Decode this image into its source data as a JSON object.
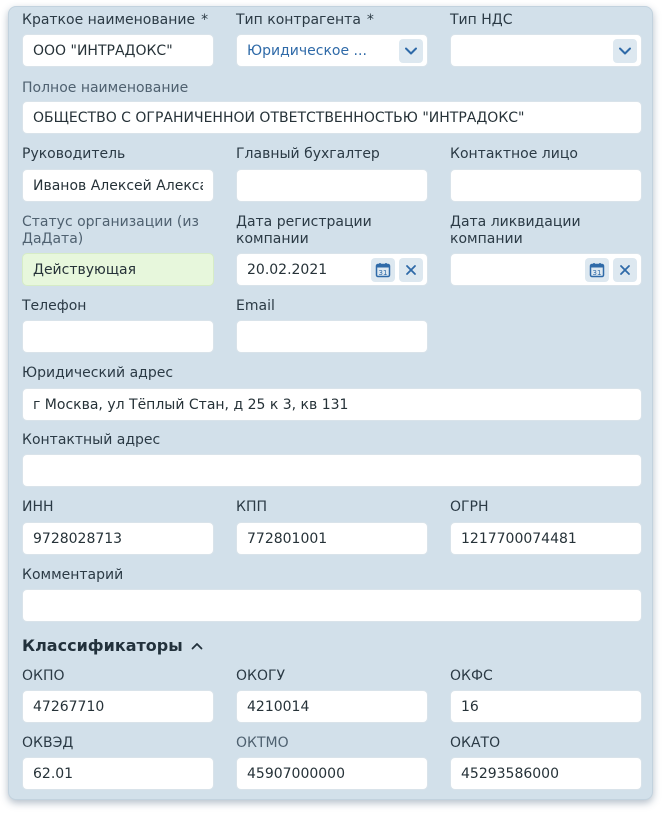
{
  "form": {
    "short_name_label": "Краткое наименование",
    "short_name_required": "*",
    "short_name_value": "ООО \"ИНТРАДОКС\"",
    "contractor_type_label": "Тип контрагента",
    "contractor_type_required": "*",
    "contractor_type_value": "Юридическое ...",
    "vat_type_label": "Тип НДС",
    "vat_type_value": "",
    "full_name_label": "Полное наименование",
    "full_name_value": "ОБЩЕСТВО С ОГРАНИЧЕННОЙ ОТВЕТСТВЕННОСТЬЮ \"ИНТРАДОКС\"",
    "director_label": "Руководитель",
    "director_value": "Иванов Алексей Александрович",
    "chief_accountant_label": "Главный бухгалтер",
    "chief_accountant_value": "",
    "contact_person_label": "Контактное лицо",
    "contact_person_value": "",
    "org_status_label": "Статус организации (из ДаДата)",
    "org_status_value": "Действующая",
    "reg_date_label": "Дата регистрации компании",
    "reg_date_value": "20.02.2021",
    "liquidation_date_label": "Дата ликвидации компании",
    "liquidation_date_value": "",
    "phone_label": "Телефон",
    "phone_value": "",
    "email_label": "Email",
    "email_value": "",
    "legal_address_label": "Юридический адрес",
    "legal_address_value": "г Москва, ул Тёплый Стан, д 25 к 3, кв 131",
    "contact_address_label": "Контактный адрес",
    "contact_address_value": "",
    "inn_label": "ИНН",
    "inn_value": "9728028713",
    "kpp_label": "КПП",
    "kpp_value": "772801001",
    "ogrn_label": "ОГРН",
    "ogrn_value": "1217700074481",
    "comment_label": "Комментарий",
    "comment_value": ""
  },
  "classifiers": {
    "title": "Классификаторы",
    "okpo_label": "ОКПО",
    "okpo_value": "47267710",
    "okogu_label": "ОКОГУ",
    "okogu_value": "4210014",
    "okfs_label": "ОКФС",
    "okfs_value": "16",
    "okved_label": "ОКВЭД",
    "okved_value": "62.01",
    "oktmo_label": "ОКТМО",
    "oktmo_value": "45907000000",
    "okato_label": "ОКАТО",
    "okato_value": "45293586000"
  },
  "icons": {
    "dropdown": "chevron-down-icon",
    "calendar": "calendar-icon",
    "clear": "close-icon",
    "collapse": "chevron-up-icon"
  },
  "colors": {
    "panel_bg": "#d2e0ea",
    "accent": "#2f6aa8",
    "status_ok_bg": "#e7f7dc"
  }
}
